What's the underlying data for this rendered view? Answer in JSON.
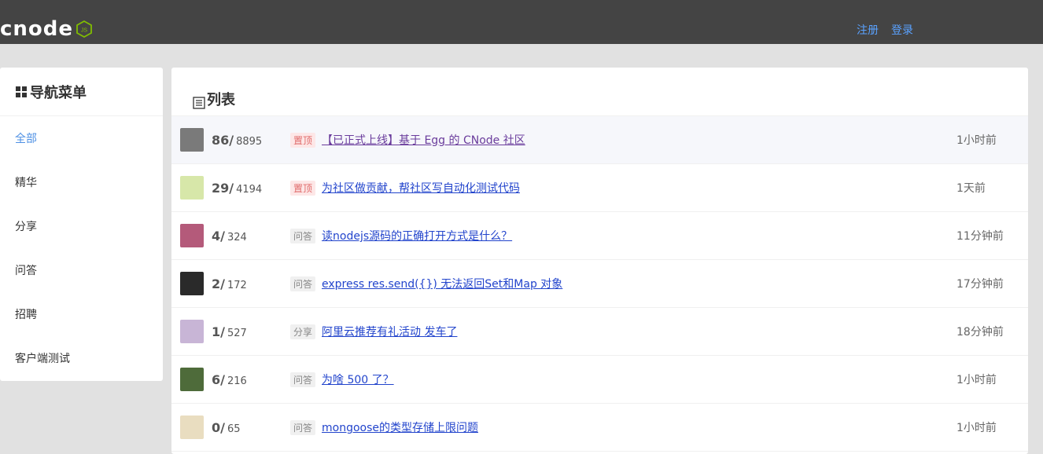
{
  "brand": {
    "logo_text": "cnode",
    "logo_badge": "JS",
    "accent": "#80bd01"
  },
  "header": {
    "register_label": "注册",
    "login_label": "登录"
  },
  "sidebar": {
    "title": "导航菜单",
    "items": [
      {
        "label": "全部",
        "active": true
      },
      {
        "label": "精华"
      },
      {
        "label": "分享"
      },
      {
        "label": "问答"
      },
      {
        "label": "招聘"
      },
      {
        "label": "客户端测试"
      }
    ]
  },
  "list": {
    "title": "列表",
    "rows": [
      {
        "reply": "86",
        "visit": "8895",
        "tag": "置顶",
        "title": "【已正式上线】基于 Egg 的 CNode 社区",
        "time": "1小时前",
        "avatar_color": "#7a7a7a"
      },
      {
        "reply": "29",
        "visit": "4194",
        "tag": "置顶",
        "title": "为社区做贡献，帮社区写自动化测试代码",
        "time": "1天前",
        "avatar_color": "#d7e7a9"
      },
      {
        "reply": "4",
        "visit": "324",
        "tag": "问答",
        "title": "读nodejs源码的正确打开方式是什么？",
        "time": "11分钟前",
        "avatar_color": "#b45a7a"
      },
      {
        "reply": "2",
        "visit": "172",
        "tag": "问答",
        "title": "express res.send({}) 无法返回Set和Map 对象",
        "time": "17分钟前",
        "avatar_color": "#2a2a2a"
      },
      {
        "reply": "1",
        "visit": "527",
        "tag": "分享",
        "title": "阿里云推荐有礼活动 发车了",
        "time": "18分钟前",
        "avatar_color": "#c8b5d6"
      },
      {
        "reply": "6",
        "visit": "216",
        "tag": "问答",
        "title": "为啥 500 了？",
        "time": "1小时前",
        "avatar_color": "#4e6b3a"
      },
      {
        "reply": "0",
        "visit": "65",
        "tag": "问答",
        "title": "mongoose的类型存储上限问题",
        "time": "1小时前",
        "avatar_color": "#e9ddc0"
      }
    ]
  }
}
